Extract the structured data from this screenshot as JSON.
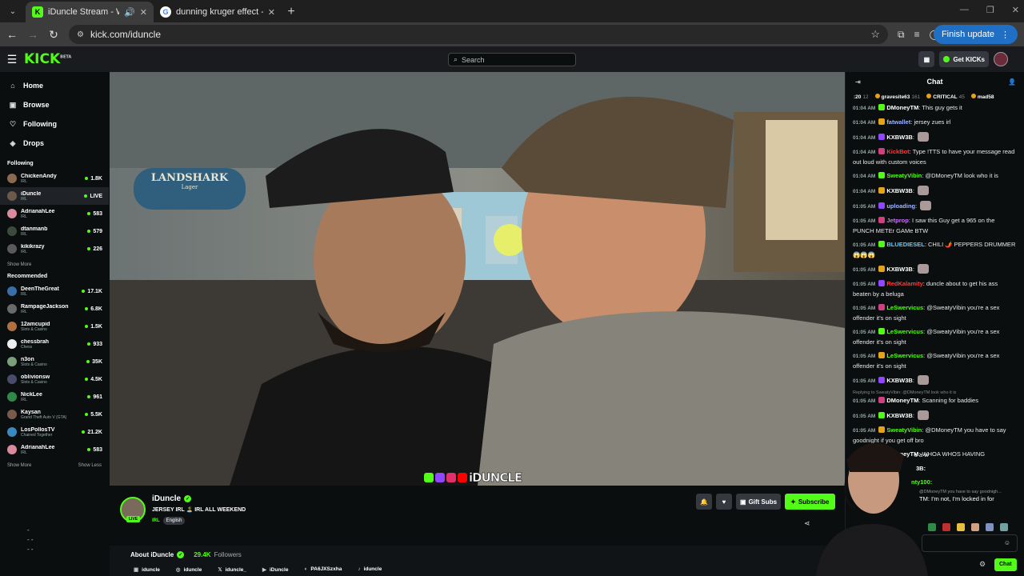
{
  "browser": {
    "tabs": [
      {
        "title": "iDuncle Stream - Watch Live",
        "active": true
      },
      {
        "title": "dunning kruger effect - Google",
        "active": false
      }
    ],
    "url": "kick.com/iduncle",
    "finish_update": "Finish update"
  },
  "header": {
    "logo": "KICK",
    "logo_beta": "BETA",
    "search_placeholder": "Search",
    "get_kicks": "Get KICKs"
  },
  "sidebar": {
    "nav": [
      {
        "label": "Home",
        "icon": "home-icon"
      },
      {
        "label": "Browse",
        "icon": "browse-icon"
      },
      {
        "label": "Following",
        "icon": "heart-icon"
      },
      {
        "label": "Drops",
        "icon": "drops-icon"
      }
    ],
    "following_title": "Following",
    "following": [
      {
        "name": "ChickenAndy",
        "category": "IRL",
        "count": "1.8K",
        "color": "#8c6a50"
      },
      {
        "name": "iDuncle",
        "category": "IRL",
        "count": "LIVE",
        "color": "#6b5a4c"
      },
      {
        "name": "AdrianahLee",
        "category": "IRL",
        "count": "583",
        "color": "#d98aa0"
      },
      {
        "name": "dtanmanb",
        "category": "IRL",
        "count": "579",
        "color": "#3c4a3c"
      },
      {
        "name": "kikikrazy",
        "category": "IRL",
        "count": "226",
        "color": "#5a5a5a"
      }
    ],
    "show_more_1": "Show More",
    "recommended_title": "Recommended",
    "recommended": [
      {
        "name": "DeenTheGreat",
        "category": "IRL",
        "count": "17.1K",
        "color": "#3a6ea8"
      },
      {
        "name": "RampageJackson",
        "category": "IRL",
        "count": "6.8K",
        "color": "#6a6a6a"
      },
      {
        "name": "12amcupid",
        "category": "Slots & Casino",
        "count": "1.5K",
        "color": "#b07040"
      },
      {
        "name": "chessbrah",
        "category": "Chess",
        "count": "933",
        "color": "#eeeeee"
      },
      {
        "name": "n3on",
        "category": "Slots & Casino",
        "count": "35K",
        "color": "#7aa07a"
      },
      {
        "name": "oblivionsw",
        "category": "Slots & Casino",
        "count": "4.5K",
        "color": "#4a4a6a"
      },
      {
        "name": "NickLee",
        "category": "IRL",
        "count": "961",
        "color": "#2f8a4a"
      },
      {
        "name": "Kaysan",
        "category": "Grand Theft Auto V (GTA)",
        "count": "5.5K",
        "color": "#7a5a4a"
      },
      {
        "name": "LosPollosTV",
        "category": "Chained Together",
        "count": "21.2K",
        "color": "#3a8ac0"
      },
      {
        "name": "AdrianahLee",
        "category": "IRL",
        "count": "583",
        "color": "#d98aa0"
      }
    ],
    "show_more_2": "Show More",
    "show_less": "Show Less"
  },
  "video": {
    "watermark": "iDUNCLE",
    "bar_sign": "LANDSHARK",
    "bar_sign_sub": "Lager"
  },
  "stream": {
    "name": "iDuncle",
    "live": "LIVE",
    "title": "JERSEY IRL 🏝️ IRL ALL WEEKEND",
    "category": "IRL",
    "language": "English",
    "gift_subs": "Gift Subs",
    "subscribe": "Subscribe",
    "about_label": "About iDuncle",
    "followers_count": "29.4K",
    "followers_label": "Followers",
    "socials": [
      {
        "icon": "kick-icon",
        "label": "iduncle"
      },
      {
        "icon": "instagram-icon",
        "label": "iduncle"
      },
      {
        "icon": "x-icon",
        "label": "iduncle_"
      },
      {
        "icon": "youtube-icon",
        "label": "iDuncle"
      },
      {
        "icon": "discord-icon",
        "label": "PA6JXSzxha"
      },
      {
        "icon": "tiktok-icon",
        "label": "iduncle"
      }
    ]
  },
  "chat": {
    "title": "Chat",
    "gifters": [
      {
        "name": ":20",
        "count": "12"
      },
      {
        "name": "gravesite63",
        "count": "161"
      },
      {
        "name": "CRITICAL",
        "count": "45"
      },
      {
        "name": "mad58",
        "count": ""
      }
    ],
    "messages": [
      {
        "time": "01:04 AM",
        "user": "DMoneyTM",
        "color": "#ffffff",
        "text": "This guy gets it"
      },
      {
        "time": "01:04 AM",
        "user": "fatwallet",
        "color": "#9fb5ff",
        "text": "jersey zues irl"
      },
      {
        "time": "01:04 AM",
        "user": "KXBW3B",
        "color": "#ffffff",
        "text": ""
      },
      {
        "time": "01:04 AM",
        "user": "KickBot",
        "color": "#ff3b3b",
        "text": "Type !TTS to have your message read out loud with custom voices"
      },
      {
        "time": "01:04 AM",
        "user": "SweatyVibin",
        "color": "#53fc18",
        "text": "@DMoneyTM look who it is"
      },
      {
        "time": "01:04 AM",
        "user": "KXBW3B",
        "color": "#ffffff",
        "text": ""
      },
      {
        "time": "01:05 AM",
        "user": "uploading",
        "color": "#9fb5ff",
        "text": ""
      },
      {
        "time": "01:05 AM",
        "user": "Jetprop",
        "color": "#d070ff",
        "text": "I saw this Guy get a 965 on the PUNCH METEr GAMe BTW"
      },
      {
        "time": "01:05 AM",
        "user": "BLUEDIESEL",
        "color": "#5ad0ff",
        "text": "CHILI 🌶️ PEPPERS DRUMMER 😱😱😱"
      },
      {
        "time": "01:05 AM",
        "user": "KXBW3B",
        "color": "#ffffff",
        "text": ""
      },
      {
        "time": "01:05 AM",
        "user": "RedKalamity",
        "color": "#ff3b3b",
        "text": "duncle about to get his ass beaten by a beluga"
      },
      {
        "time": "01:05 AM",
        "user": "LeSwervicus",
        "color": "#53fc18",
        "text": "@SweatyVibin you're a sex offender it's on sight"
      },
      {
        "time": "01:05 AM",
        "user": "LeSwervicus",
        "color": "#53fc18",
        "text": "@SweatyVibin you're a sex offender it's on sight"
      },
      {
        "time": "01:05 AM",
        "user": "LeSwervicus",
        "color": "#53fc18",
        "text": "@SweatyVibin you're a sex offender it's on sight"
      },
      {
        "time": "01:05 AM",
        "user": "KXBW3B",
        "color": "#ffffff",
        "text": ""
      },
      {
        "time": "01:05 AM",
        "user": "DMoneyTM",
        "color": "#ffffff",
        "text": "Scanning for baddies",
        "reply": "Replying to SweatyVibin: @DMoneyTM look who it is"
      },
      {
        "time": "01:05 AM",
        "user": "KXBW3B",
        "color": "#ffffff",
        "text": ""
      },
      {
        "time": "01:05 AM",
        "user": "SweatyVibin",
        "color": "#53fc18",
        "text": "@DMoneyTM you have to say goodnight if you get off bro"
      },
      {
        "time": "01:05 AM",
        "user": "DMoneyTM",
        "color": "#ffffff",
        "text": "WHOA WHOS HAVING"
      }
    ],
    "partial_lines": [
      "s a w",
      "3B:",
      "nty100:",
      "@DMoneyTM you have to say goodnigh...",
      "TM: I'm not, I'm locked in for"
    ],
    "input_placeholder": "",
    "send_label": "Chat"
  }
}
